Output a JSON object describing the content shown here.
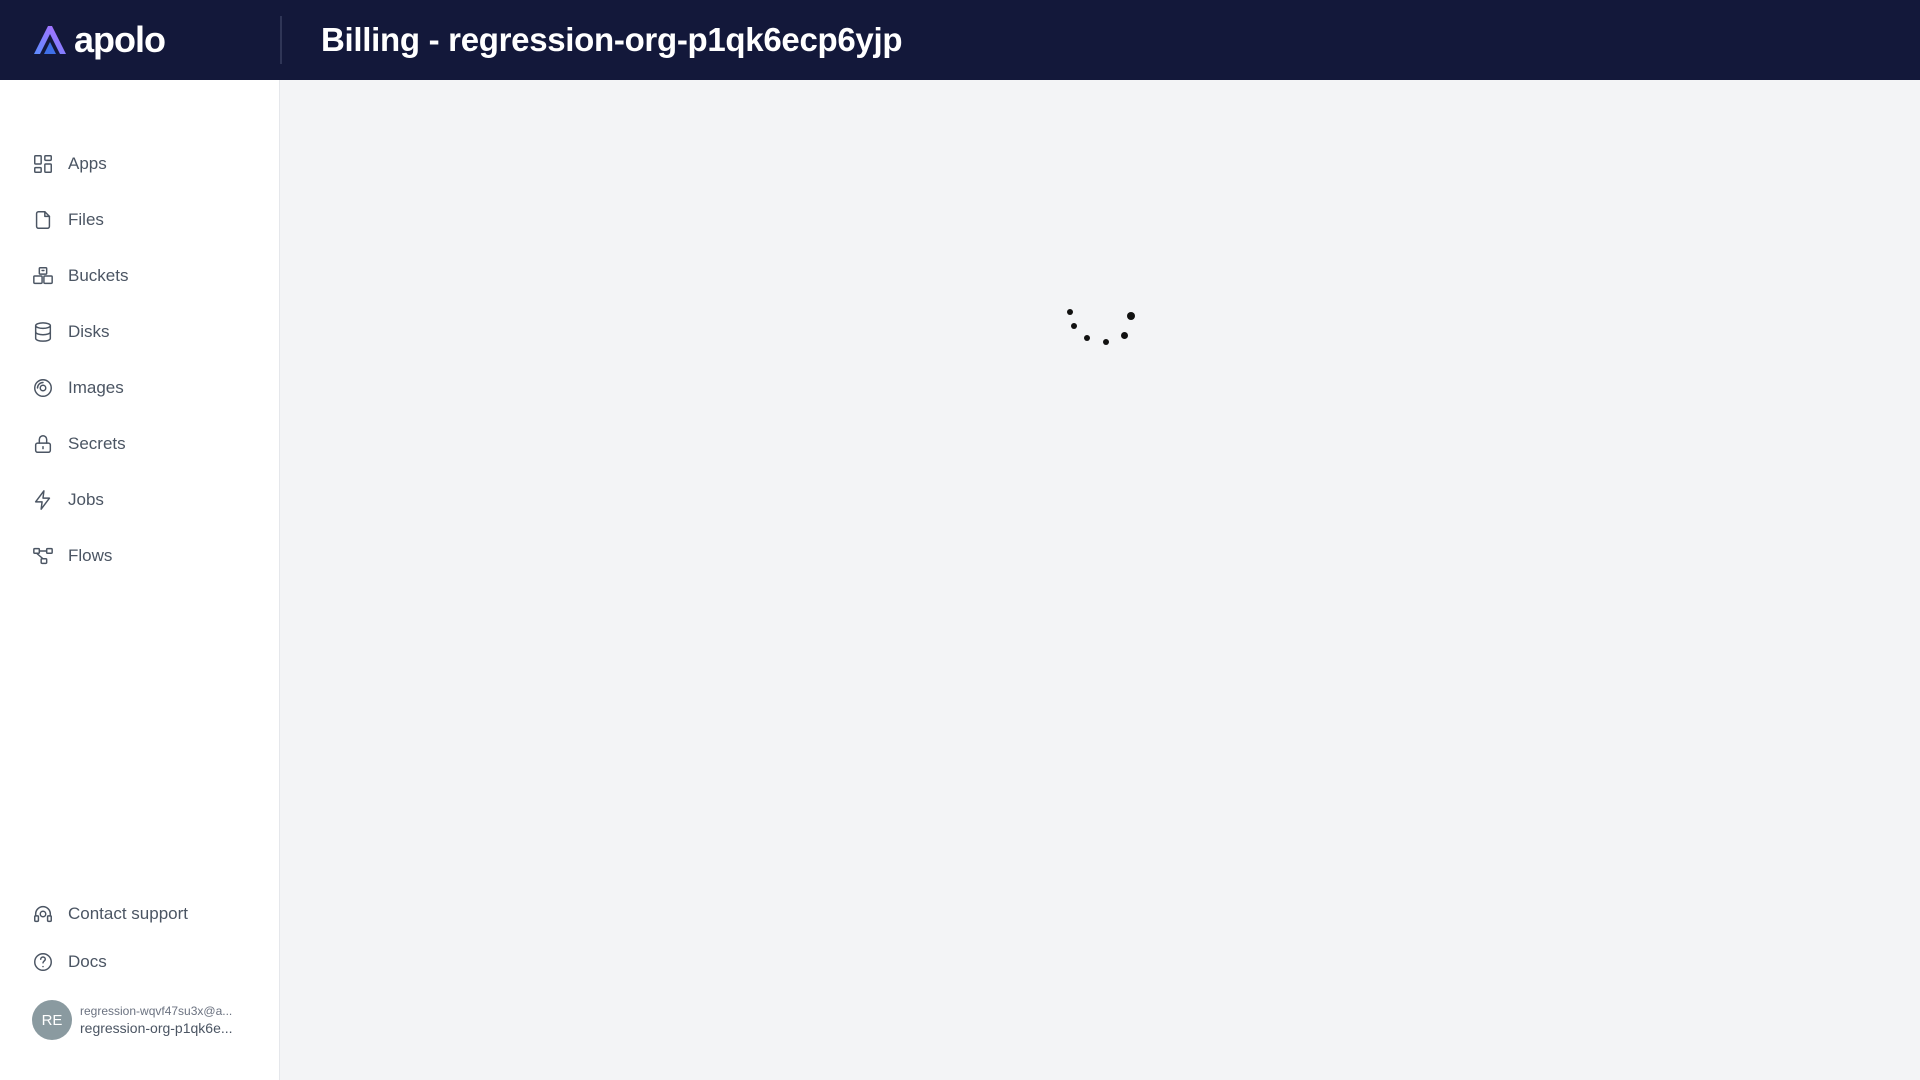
{
  "app": {
    "brand_name": "apolo",
    "page_title": "Billing - regression-org-p1qk6ecp6yjp"
  },
  "sidebar": {
    "items": [
      {
        "label": "Apps",
        "icon": "apps-icon"
      },
      {
        "label": "Files",
        "icon": "file-icon"
      },
      {
        "label": "Buckets",
        "icon": "buckets-icon"
      },
      {
        "label": "Disks",
        "icon": "database-icon"
      },
      {
        "label": "Images",
        "icon": "disc-icon"
      },
      {
        "label": "Secrets",
        "icon": "lock-icon"
      },
      {
        "label": "Jobs",
        "icon": "lightning-icon"
      },
      {
        "label": "Flows",
        "icon": "workflow-icon"
      }
    ],
    "bottom": [
      {
        "label": "Contact support",
        "icon": "headset-icon"
      },
      {
        "label": "Docs",
        "icon": "help-circle-icon"
      }
    ],
    "user": {
      "initials": "RE",
      "email": "regression-wqvf47su3x@a...",
      "org": "regression-org-p1qk6e..."
    }
  },
  "colors": {
    "topbar": "#13183a",
    "sidebar": "#ffffff",
    "main_bg": "#f3f4f6",
    "brand_gradient_start": "#5b8cff",
    "brand_gradient_end": "#b56cff"
  }
}
